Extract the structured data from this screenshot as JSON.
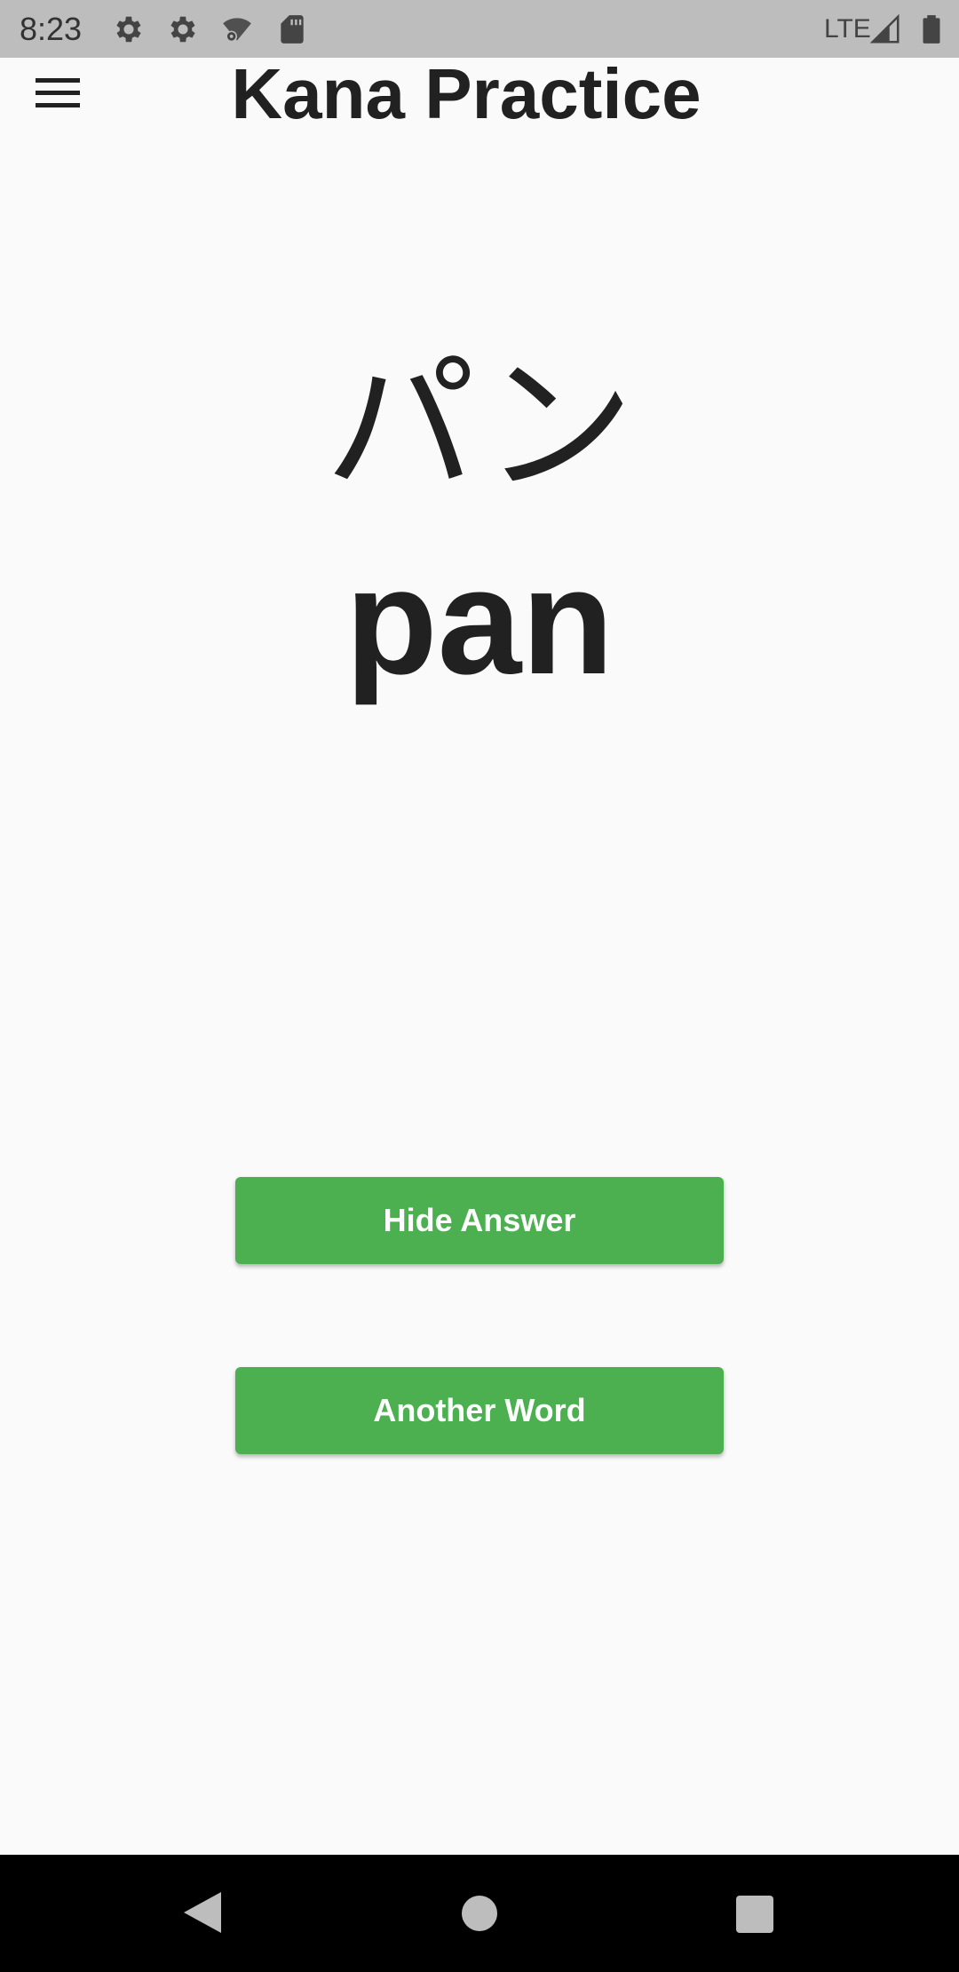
{
  "status_bar": {
    "time": "8:23",
    "icons": [
      "gear-icon",
      "gear-icon",
      "wifi-settings-icon",
      "sd-card-icon"
    ],
    "network": "LTE",
    "right_icons": [
      "cell-signal-icon",
      "battery-icon"
    ]
  },
  "app_bar": {
    "menu_icon": "hamburger-menu-icon",
    "title": "Kana Practice"
  },
  "practice": {
    "kana": "パン",
    "romaji": "pan"
  },
  "buttons": {
    "hide_answer": "Hide Answer",
    "another_word": "Another Word"
  },
  "colors": {
    "button": "#4caf50",
    "background": "#fafafa",
    "status_bar": "#bdbdbd",
    "nav_bar": "#000000"
  },
  "nav_bar": {
    "icons": [
      "back-icon",
      "home-icon",
      "recents-icon"
    ]
  }
}
